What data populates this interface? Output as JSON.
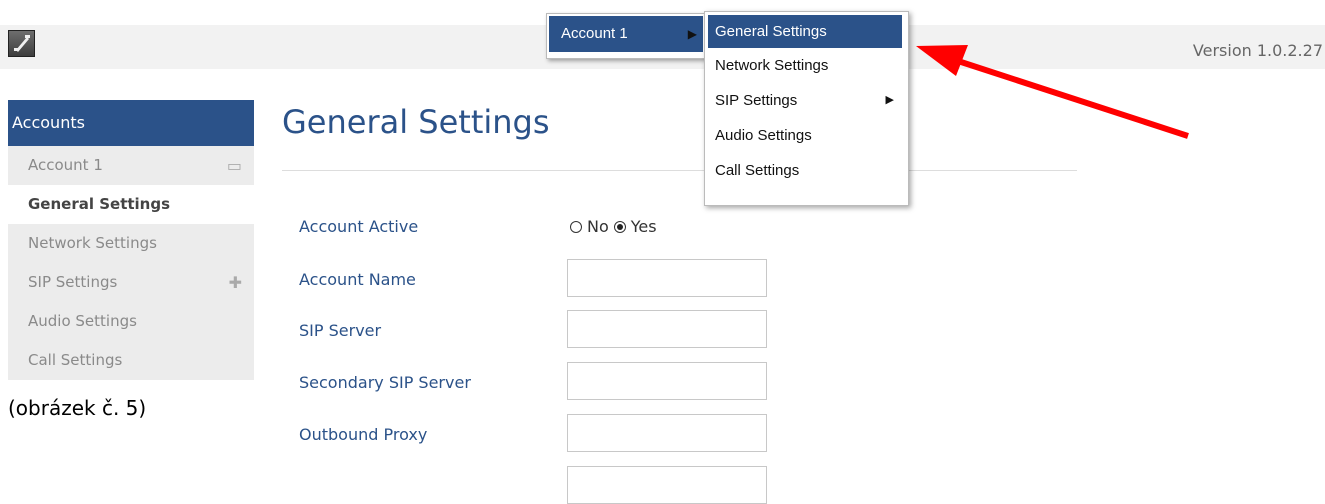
{
  "topbar": {
    "version": "Version 1.0.2.27"
  },
  "sidebar": {
    "header": "Accounts",
    "account": "Account 1",
    "items": [
      {
        "label": "General Settings",
        "active": true
      },
      {
        "label": "Network Settings"
      },
      {
        "label": "SIP Settings"
      },
      {
        "label": "Audio Settings"
      },
      {
        "label": "Call Settings"
      }
    ]
  },
  "caption": "(obrázek č. 5)",
  "main": {
    "title": "General Settings",
    "fields": {
      "account_active": "Account Active",
      "radio_no": "No",
      "radio_yes": "Yes",
      "account_name": "Account Name",
      "sip_server": "SIP Server",
      "secondary_sip_server": "Secondary SIP Server",
      "outbound_proxy": "Outbound Proxy"
    }
  },
  "context_menu": {
    "parent": "Account 1",
    "items": [
      "General Settings",
      "Network Settings",
      "SIP Settings",
      "Audio Settings",
      "Call Settings"
    ]
  },
  "colors": {
    "accent": "#2b5289",
    "annotation_arrow": "#ff0000"
  }
}
